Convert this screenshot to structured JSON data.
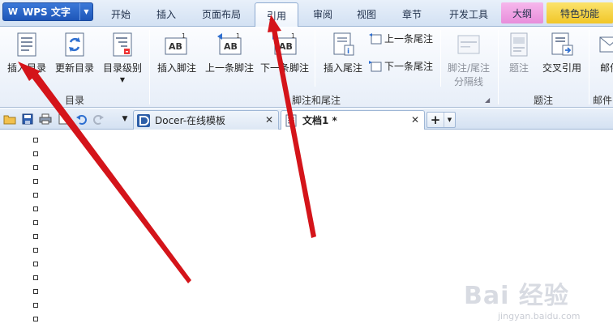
{
  "app": {
    "name": "WPS 文字"
  },
  "menu_tabs": [
    "开始",
    "插入",
    "页面布局",
    "引用",
    "审阅",
    "视图",
    "章节",
    "开发工具",
    "大纲",
    "特色功能"
  ],
  "active_tab": "引用",
  "ribbon": {
    "toc_group": {
      "label": "目录",
      "insert_toc": "插入目录",
      "update_toc": "更新目录",
      "toc_level": "目录级别"
    },
    "footnote_group": {
      "label": "脚注和尾注",
      "insert_footnote": "插入脚注",
      "prev_footnote": "上一条脚注",
      "next_footnote": "下一条脚注",
      "insert_endnote": "插入尾注",
      "prev_endnote": "上一条尾注",
      "next_endnote": "下一条尾注",
      "separator_line_1": "脚注/尾注",
      "separator_line_2": "分隔线"
    },
    "caption_group": {
      "label": "题注",
      "caption": "题注",
      "cross_ref": "交叉引用"
    },
    "mail_group": {
      "label": "邮件",
      "mail_btn": "邮件"
    }
  },
  "doc_tabs": [
    {
      "title": "Docer-在线模板",
      "active": false
    },
    {
      "title": "文档1 *",
      "active": true
    }
  ],
  "new_tab_label": "+",
  "watermark": {
    "brand": "Bai 经验",
    "url": "jingyan.baidu.com"
  },
  "colors": {
    "wps_blue": "#1e56b8",
    "outline_tab": "#e88ddb",
    "special_tab": "#f1c628",
    "arrow": "#d4141a"
  }
}
